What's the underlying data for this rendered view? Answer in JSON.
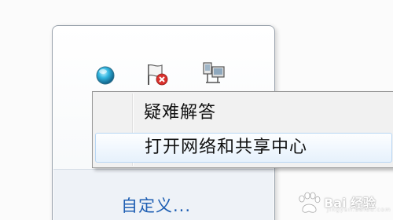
{
  "tray": {
    "icons": [
      {
        "name": "network-status-icon"
      },
      {
        "name": "action-center-flag-error-icon"
      },
      {
        "name": "network-connection-icon"
      }
    ],
    "customize_label": "自定义..."
  },
  "context_menu": {
    "items": [
      {
        "label": "疑难解答",
        "highlighted": false
      },
      {
        "label": "打开网络和共享中心",
        "highlighted": true
      }
    ]
  },
  "watermark": {
    "text": "Bai 经验",
    "subtext": "jingyan.baidu.com"
  },
  "colors": {
    "menu_highlight": "#e6f1fc",
    "link": "#1f5fb3",
    "error_red": "#d9302c"
  }
}
